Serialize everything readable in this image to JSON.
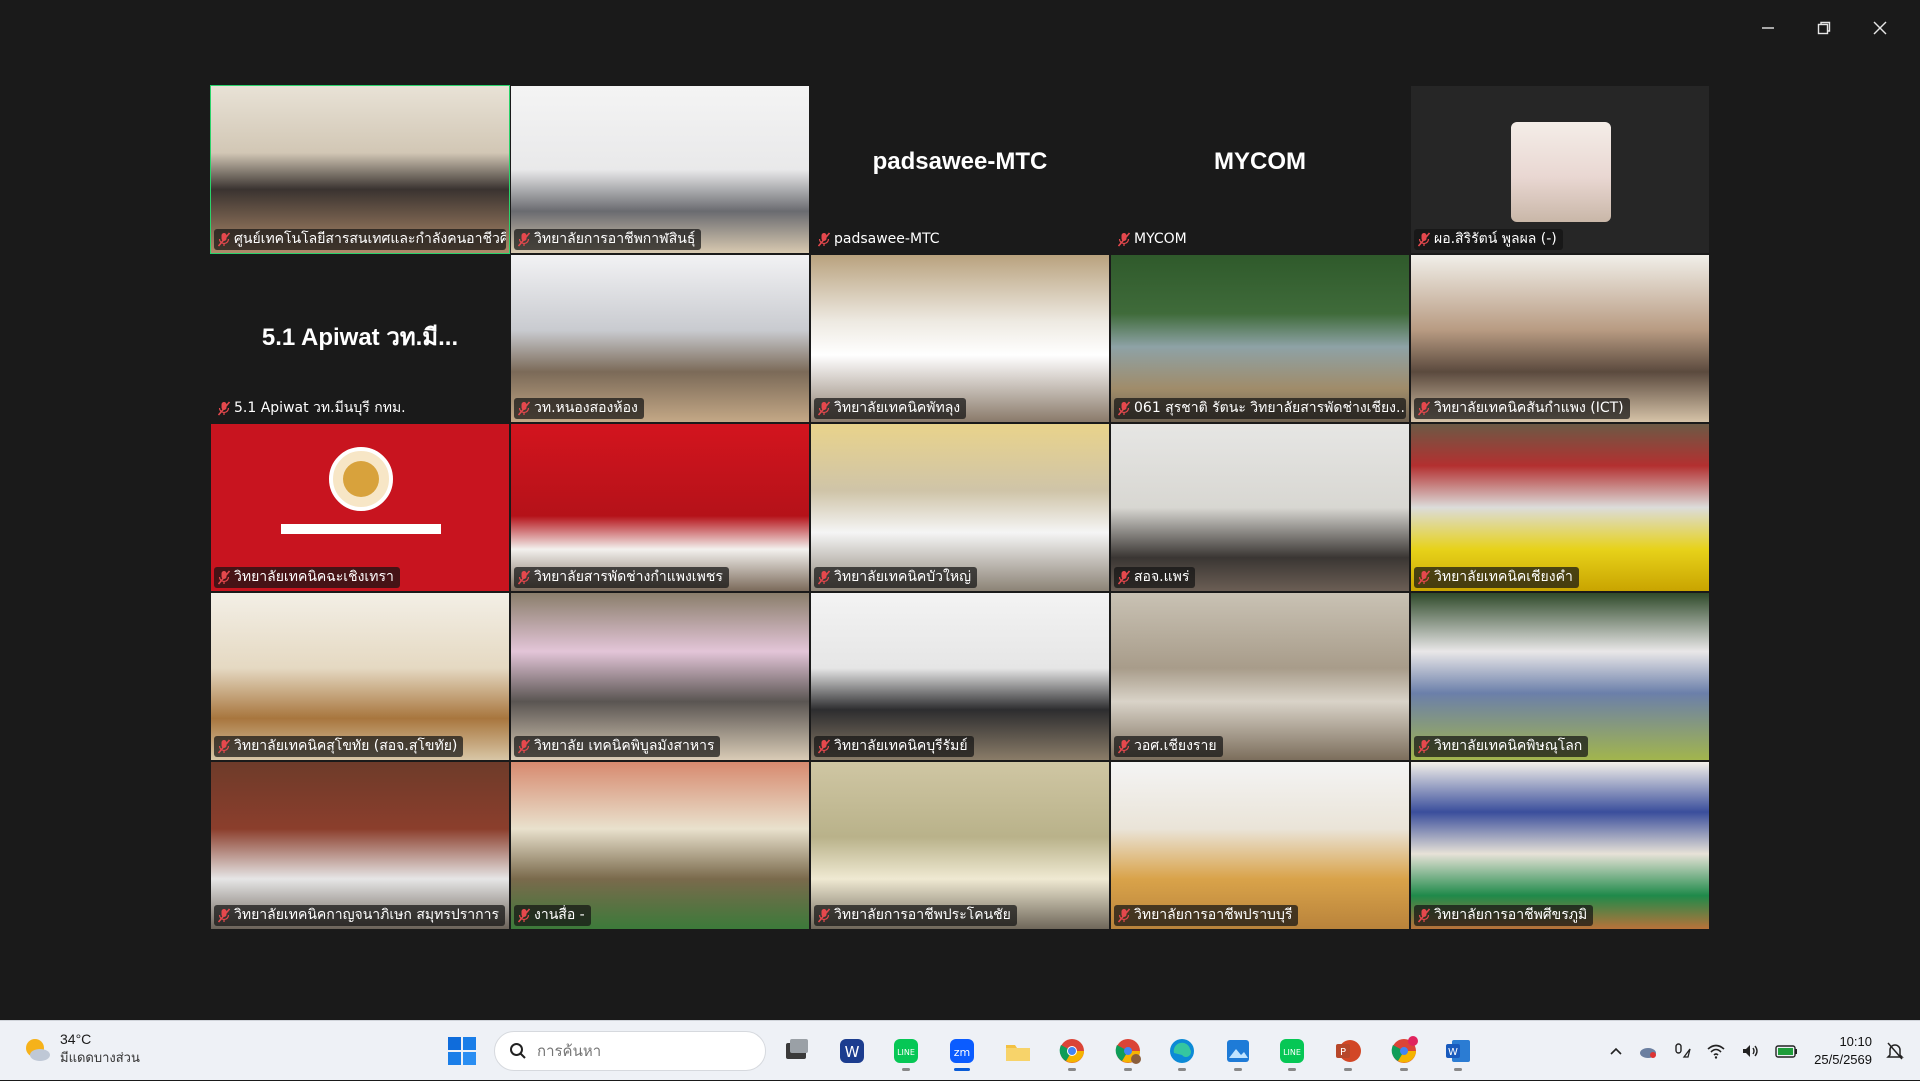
{
  "window": {
    "controls": [
      "minimize",
      "restore",
      "close"
    ]
  },
  "tiles": [
    {
      "label": "ศูนย์เทคโนโลยีสารสนเทศและกำลังคนอาชีวศึก...",
      "big": "",
      "kind": "video",
      "active": true
    },
    {
      "label": "วิทยาลัยการอาชีพกาฬสินธุ์",
      "big": "",
      "kind": "video"
    },
    {
      "label": "padsawee-MTC",
      "big": "padsawee-MTC",
      "kind": "blank"
    },
    {
      "label": "MYCOM",
      "big": "MYCOM",
      "kind": "blank"
    },
    {
      "label": "ผอ.สิริรัตน์ พูลผล (-)",
      "big": "",
      "kind": "avatar"
    },
    {
      "label": "5.1 Apiwat วท.มีนบุรี กทม.",
      "big": "5.1 Apiwat วท.มี...",
      "kind": "blank"
    },
    {
      "label": "วท.หนองสองห้อง",
      "big": "",
      "kind": "video"
    },
    {
      "label": "วิทยาลัยเทคนิคพัทลุง",
      "big": "",
      "kind": "video"
    },
    {
      "label": "061 สุรชาติ รัตนะ วิทยาลัยสารพัดช่างเชียง...",
      "big": "",
      "kind": "video"
    },
    {
      "label": "วิทยาลัยเทคนิคสันกำแพง (ICT)",
      "big": "",
      "kind": "video"
    },
    {
      "label": "วิทยาลัยเทคนิคฉะเชิงเทรา",
      "big": "",
      "kind": "red"
    },
    {
      "label": "วิทยาลัยสารพัดช่างกำแพงเพชร",
      "big": "",
      "kind": "video"
    },
    {
      "label": "วิทยาลัยเทคนิคบัวใหญ่",
      "big": "",
      "kind": "video"
    },
    {
      "label": "สอจ.แพร่",
      "big": "",
      "kind": "video"
    },
    {
      "label": "วิทยาลัยเทคนิคเชียงคำ",
      "big": "",
      "kind": "video"
    },
    {
      "label": "วิทยาลัยเทคนิคสุโขทัย (สอจ.สุโขทัย)",
      "big": "",
      "kind": "video"
    },
    {
      "label": "วิทยาลัย เทคนิคพิบูลมังสาหาร",
      "big": "",
      "kind": "video"
    },
    {
      "label": "วิทยาลัยเทคนิคบุรีรัมย์",
      "big": "",
      "kind": "video"
    },
    {
      "label": "วอศ.เชียงราย",
      "big": "",
      "kind": "video"
    },
    {
      "label": "วิทยาลัยเทคนิคพิษณุโลก",
      "big": "",
      "kind": "video"
    },
    {
      "label": "วิทยาลัยเทคนิคกาญจนาภิเษก สมุทรปราการ",
      "big": "",
      "kind": "video"
    },
    {
      "label": "งานสื่อ -",
      "big": "",
      "kind": "video"
    },
    {
      "label": "วิทยาลัยการอาชีพประโคนชัย",
      "big": "",
      "kind": "video"
    },
    {
      "label": "วิทยาลัยการอาชีพปราบบุรี",
      "big": "",
      "kind": "video"
    },
    {
      "label": "วิทยาลัยการอาชีพศีขรภูมิ",
      "big": "",
      "kind": "video"
    }
  ],
  "taskbar": {
    "weather": {
      "temp": "34°C",
      "desc": "มีแดดบางส่วน"
    },
    "search_placeholder": "การค้นหา",
    "apps": [
      "task-view",
      "app-w",
      "line",
      "zoom",
      "file-explorer",
      "chrome",
      "chrome-profile",
      "edge",
      "photos",
      "line-2",
      "powerpoint",
      "chrome-k",
      "word"
    ],
    "clock": {
      "time": "10:10",
      "date": "25/5/2569"
    }
  }
}
